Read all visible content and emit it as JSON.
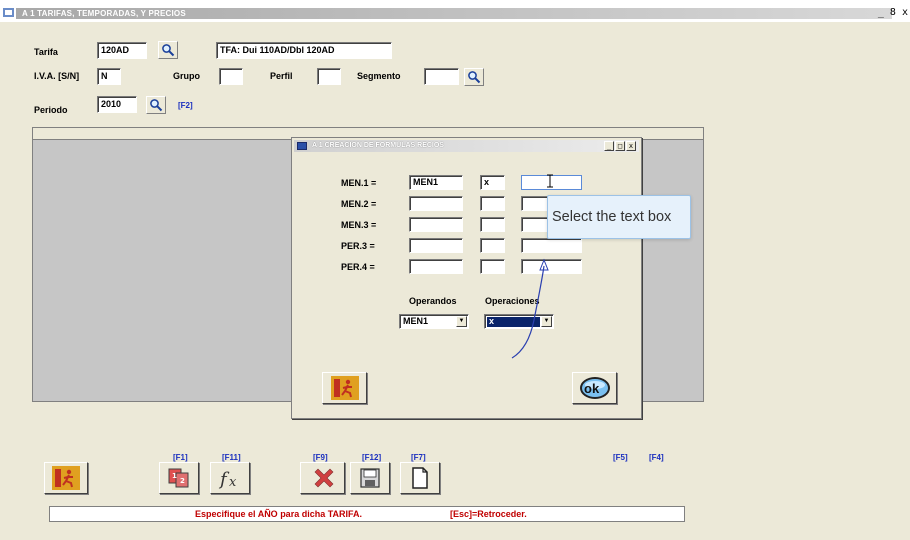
{
  "window": {
    "title": "A 1  TARIFAS, TEMPORADAS, Y PRECIOS",
    "controls": "_ 8 x"
  },
  "form": {
    "tarifa_label": "Tarifa",
    "tarifa_value": "120AD",
    "tarifa_desc": "TFA: Dui 110AD/Dbl 120AD",
    "iva_label": "I.V.A. [S/N]",
    "iva_value": "N",
    "grupo_label": "Grupo",
    "grupo_value": "",
    "perfil_label": "Perfil",
    "perfil_value": "",
    "segmento_label": "Segmento",
    "segmento_value": "",
    "periodo_label": "Periodo",
    "periodo_value": "2010",
    "periodo_fkey": "[F2]"
  },
  "dialog": {
    "title": "A 1 CREACION DE FORMULAS    RECIOS",
    "rows": [
      {
        "label": "MEN.1 =",
        "op1": "MEN1",
        "op2": "x",
        "op3": ""
      },
      {
        "label": "MEN.2 =",
        "op1": "",
        "op2": "",
        "op3": ""
      },
      {
        "label": "MEN.3 =",
        "op1": "",
        "op2": "",
        "op3": ""
      },
      {
        "label": "PER.3 =",
        "op1": "",
        "op2": "",
        "op3": ""
      },
      {
        "label": "PER.4 =",
        "op1": "",
        "op2": "",
        "op3": ""
      }
    ],
    "operandos_label": "Operandos",
    "operaciones_label": "Operaciones",
    "operandos_value": "MEN1",
    "operaciones_value": "x",
    "ok_label": "ok"
  },
  "tooltip": {
    "text": "Select the  text box"
  },
  "toolbar": {
    "f1": "[F1]",
    "f11": "[F11]",
    "f9": "[F9]",
    "f12": "[F12]",
    "f7": "[F7]",
    "f5": "[F5]",
    "f4": "[F4]"
  },
  "status": {
    "message": "Especifique el AÑO para dicha TARIFA.",
    "hint": "[Esc]=Retroceder."
  }
}
